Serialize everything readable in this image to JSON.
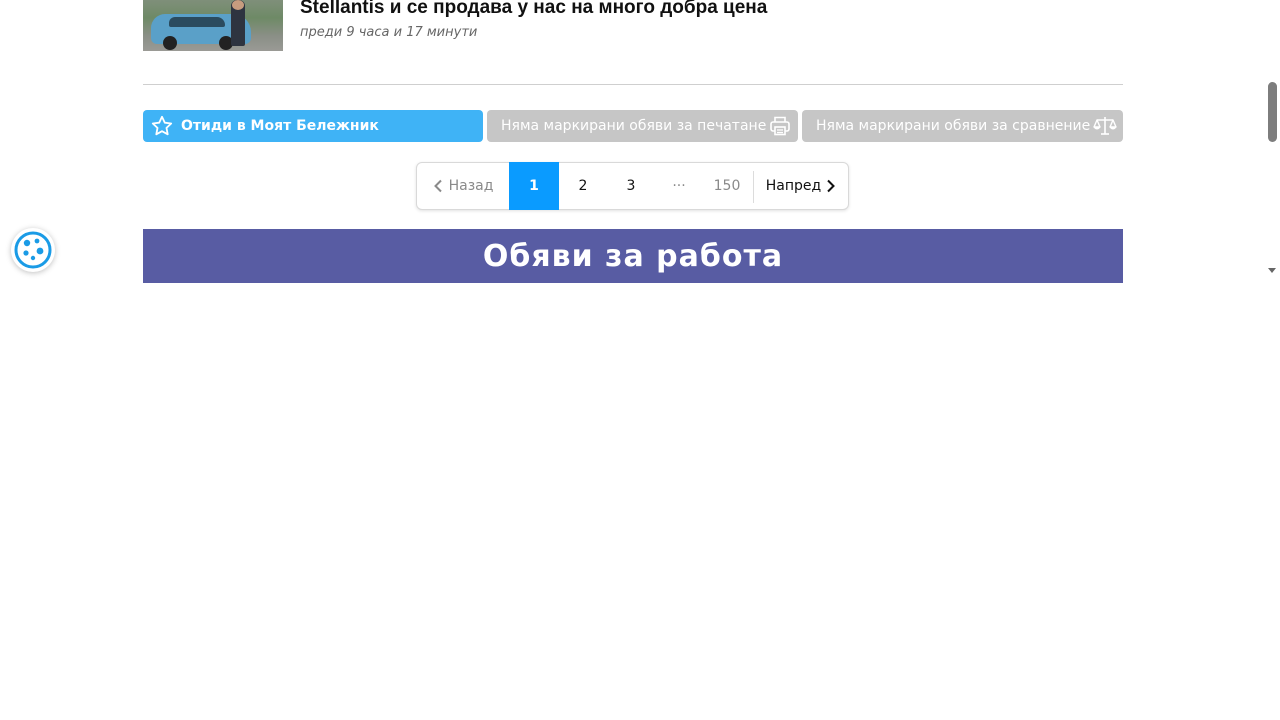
{
  "news": {
    "title": "Stellantis и се продава у нас на много добра цена",
    "time": "преди 9 часа и 17 минути"
  },
  "actions": {
    "notebook_label": "Отиди в Моят Бележник",
    "print_label": "Няма маркирани обяви за печатане",
    "compare_label": "Няма маркирани обяви за сравнение"
  },
  "pagination": {
    "prev_label": "Назад",
    "pages": [
      "1",
      "2",
      "3"
    ],
    "ellipsis": "···",
    "last_page": "150",
    "next_label": "Напред",
    "current_page": "1"
  },
  "jobs_banner": {
    "title": "Обяви за работа"
  },
  "colors": {
    "notebook_button": "#3fb3f6",
    "disabled_button": "#c6c6c6",
    "active_page": "#0a9bff",
    "jobs_banner": "#585ca3",
    "cookie_icon": "#1a9be6"
  },
  "icons": {
    "notebook": "star-outline-icon",
    "print": "printer-icon",
    "compare": "scales-icon",
    "prev": "chevron-left-icon",
    "next": "chevron-right-icon",
    "cookie": "cookie-icon"
  }
}
